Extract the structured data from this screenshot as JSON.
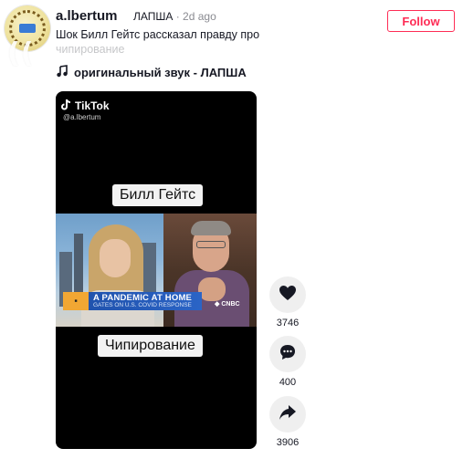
{
  "post": {
    "username": "a.lbertum",
    "nickname": "ЛАПША",
    "separator": " · ",
    "age": "2d ago",
    "description": "Шок Билл Гейтс рассказал правду про чипирование",
    "music": "оригинальный звук - ЛАПША",
    "follow_label": "Follow"
  },
  "video": {
    "brand": "TikTok",
    "handle": "@a.lbertum",
    "caption_top": "Билл Гейтс",
    "caption_bottom": "Чипирование",
    "lower_third_title": "A PANDEMIC AT HOME",
    "lower_third_sub": "GATES ON U.S. COVID RESPONSE",
    "network": "CNBC"
  },
  "actions": {
    "likes": "3746",
    "comments": "400",
    "shares": "3906"
  },
  "colors": {
    "accent": "#fe2c55",
    "text": "#161823",
    "muted": "#8a8b91",
    "action_bg": "#efefef"
  }
}
